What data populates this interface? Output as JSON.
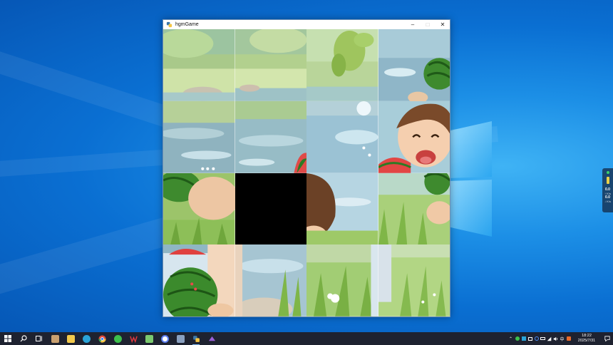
{
  "window": {
    "title": "hgmGame",
    "minimize_glyph": "–",
    "maximize_glyph": "□",
    "close_glyph": "✕",
    "icon": "python-icon"
  },
  "puzzle": {
    "rows": 4,
    "cols": 4,
    "empty_tile": {
      "row": 2,
      "col": 1
    }
  },
  "side_widget": {
    "value1": "0.0",
    "unit1": "↑ K/s",
    "value2": "0.0",
    "unit2": "↓ K/s"
  },
  "taskbar": {
    "apps": [
      {
        "name": "start-button",
        "icon": "windows-icon",
        "color": "#ffffff"
      },
      {
        "name": "search-button",
        "icon": "search-icon",
        "color": "#ffffff"
      },
      {
        "name": "task-view-button",
        "icon": "task-view-icon",
        "color": "#ffffff"
      },
      {
        "name": "app-photo",
        "icon": "photo-app-icon",
        "color": "#c9a070"
      },
      {
        "name": "app-file-explorer",
        "icon": "folder-icon",
        "color": "#f2c94c"
      },
      {
        "name": "app-edge",
        "icon": "edge-icon",
        "color": "#2aa4d8"
      },
      {
        "name": "app-chrome",
        "icon": "chrome-icon",
        "color": "#e24b3b"
      },
      {
        "name": "app-wechat",
        "icon": "wechat-icon",
        "color": "#3cc04c"
      },
      {
        "name": "app-wps",
        "icon": "wps-icon",
        "color": "#e0383e"
      },
      {
        "name": "app-notepad",
        "icon": "notepad-icon",
        "color": "#7bc96f"
      },
      {
        "name": "app-browser",
        "icon": "circle-app-icon",
        "color": "#5a7cf0"
      },
      {
        "name": "app-calculator",
        "icon": "calculator-icon",
        "color": "#8aa0c0"
      },
      {
        "name": "app-python",
        "icon": "python-icon",
        "color": "#f5c542"
      },
      {
        "name": "app-visual-studio",
        "icon": "vs-icon",
        "color": "#9a5fd6"
      }
    ],
    "tray": {
      "ime": "中",
      "time": "18:22",
      "date": "2025/7/31"
    }
  }
}
